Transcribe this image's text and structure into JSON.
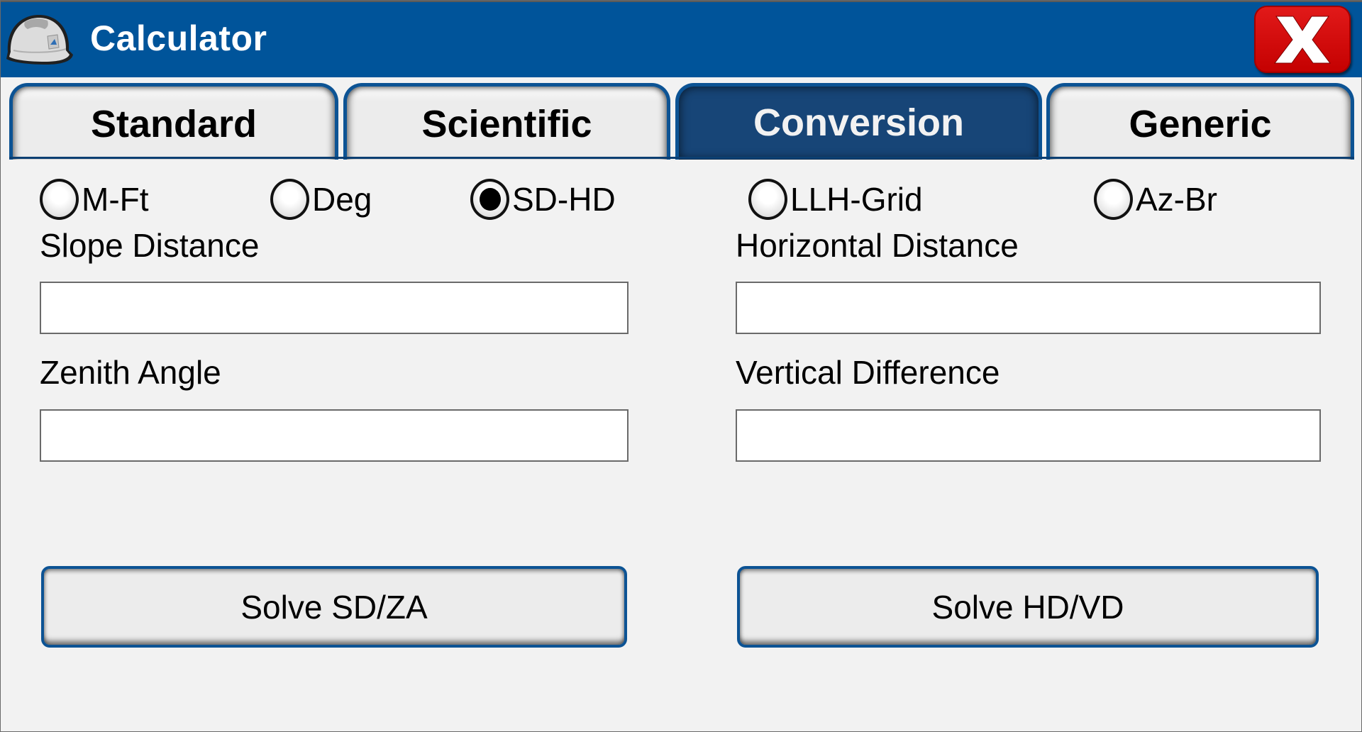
{
  "window": {
    "title": "Calculator",
    "logo_icon": "hard-hat-icon",
    "close_icon": "close-x-icon",
    "accent_color": "#00549a",
    "close_color": "#d40000"
  },
  "tabs": [
    {
      "label": "Standard",
      "active": false
    },
    {
      "label": "Scientific",
      "active": false
    },
    {
      "label": "Conversion",
      "active": true
    },
    {
      "label": "Generic",
      "active": false
    }
  ],
  "conversion": {
    "modes": [
      {
        "label": "M-Ft",
        "checked": false
      },
      {
        "label": "Deg",
        "checked": false
      },
      {
        "label": "SD-HD",
        "checked": true
      },
      {
        "label": "LLH-Grid",
        "checked": false
      },
      {
        "label": "Az-Br",
        "checked": false
      }
    ],
    "fields": {
      "slope_distance": {
        "label": "Slope Distance",
        "value": ""
      },
      "zenith_angle": {
        "label": "Zenith Angle",
        "value": ""
      },
      "horizontal_distance": {
        "label": "Horizontal Distance",
        "value": ""
      },
      "vertical_difference": {
        "label": "Vertical Difference",
        "value": ""
      }
    },
    "buttons": {
      "solve_sd_za": "Solve SD/ZA",
      "solve_hd_vd": "Solve HD/VD"
    }
  }
}
